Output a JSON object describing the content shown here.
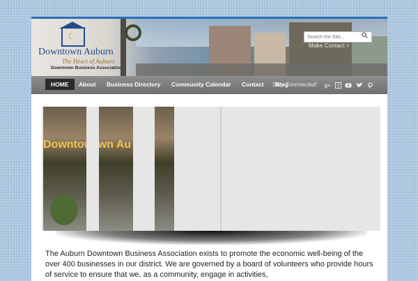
{
  "header": {
    "logo": {
      "name": "Downtown Auburn",
      "tagline": "The Heart of Auburn",
      "association": "Downtown Business Association"
    },
    "search": {
      "placeholder": "Search the Site..."
    },
    "make_contact": "Make Contact >"
  },
  "nav": {
    "items": [
      {
        "label": "HOME",
        "active": true
      },
      {
        "label": "About"
      },
      {
        "label": "Business Directory"
      },
      {
        "label": "Community Calendar"
      },
      {
        "label": "Contact"
      },
      {
        "label": "Blog"
      }
    ],
    "stay_connected": "Stay Connnected!",
    "social": [
      "google-plus-icon",
      "facebook-icon",
      "youtube-icon",
      "twitter-icon",
      "pinterest-icon"
    ]
  },
  "slider": {
    "sign_text": "Downtown Au"
  },
  "intro": {
    "text": "The Auburn Downtown Business Association exists to promote the economic well-being of the over 400 businesses in our district. We are governed by a board of volunteers who provide hours of service to ensure that we, as a community, engage in activities,"
  },
  "colors": {
    "accent": "#2a6fb8",
    "nav": "#7d7d7d",
    "active_nav": "#2a2a2a",
    "logo_blue": "#234b8a"
  }
}
